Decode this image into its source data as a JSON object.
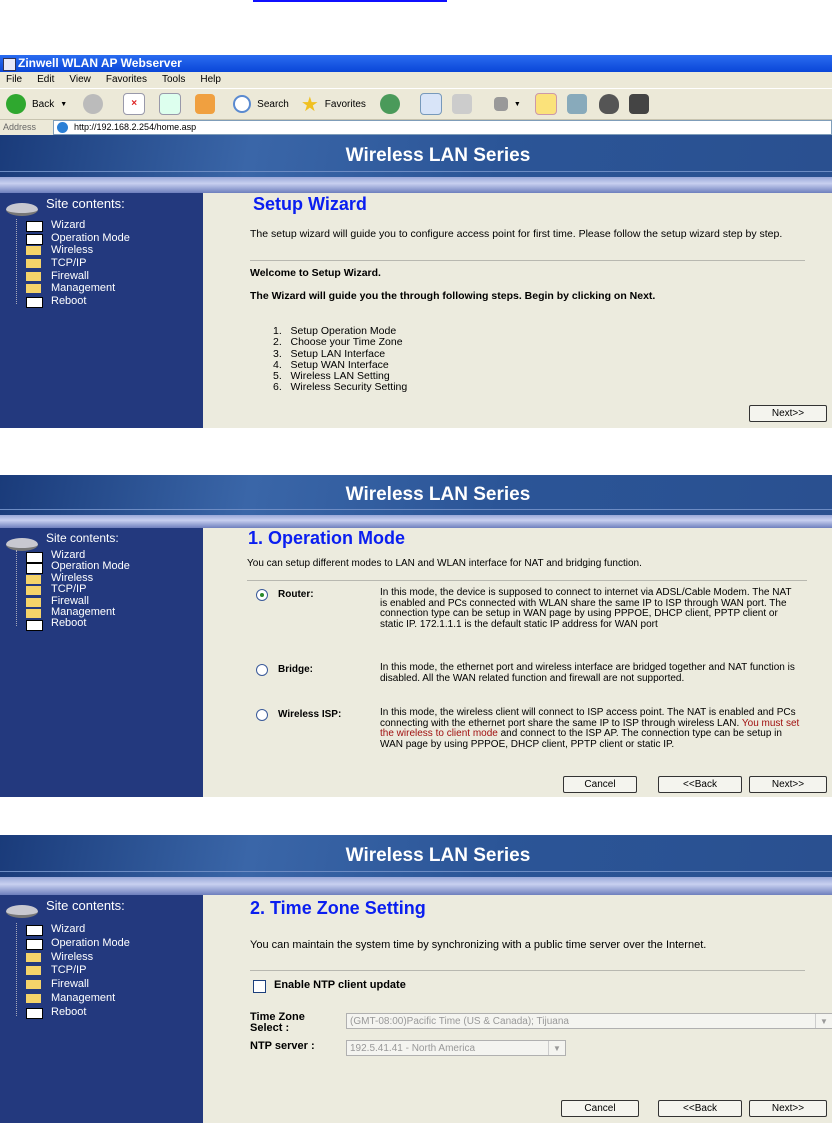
{
  "browser": {
    "title": "Zinwell WLAN AP Webserver",
    "menu": [
      "File",
      "Edit",
      "View",
      "Favorites",
      "Tools",
      "Help"
    ],
    "toolbar": {
      "back": "Back",
      "search": "Search",
      "favorites": "Favorites"
    },
    "address_label": "Address",
    "url": "http://192.168.2.254/home.asp"
  },
  "banner": "Wireless LAN Series",
  "sidebar": {
    "title": "Site contents:",
    "items": [
      "Wizard",
      "Operation Mode",
      "Wireless",
      "TCP/IP",
      "Firewall",
      "Management",
      "Reboot"
    ]
  },
  "wizard": {
    "title": "Setup Wizard",
    "intro": "The setup wizard will guide you to configure access point for first time. Please follow the setup wizard step by step.",
    "welcome": "Welcome to Setup Wizard.",
    "guide": "The Wizard will guide you the through following steps. Begin by clicking on Next.",
    "steps": [
      "1.   Setup Operation Mode",
      "2.   Choose your Time Zone",
      "3.   Setup LAN Interface",
      "4.   Setup WAN Interface",
      "5.   Wireless LAN Setting",
      "6.   Wireless Security Setting"
    ],
    "next": "Next>>"
  },
  "opmode": {
    "title": "1. Operation Mode",
    "intro": "You can setup different modes to LAN and WLAN interface for NAT and bridging function.",
    "modes": [
      {
        "label": "Router:",
        "selected": true,
        "desc": "In this mode, the device is supposed to connect to internet via ADSL/Cable Modem. The NAT is enabled and PCs connected with WLAN share the same IP to ISP through WAN port. The connection type can be setup in WAN page by using PPPOE, DHCP client, PPTP client or static IP. 172.1.1.1 is the default static IP address for WAN port"
      },
      {
        "label": "Bridge:",
        "selected": false,
        "desc": "In this mode, the ethernet port and wireless interface are bridged together and NAT function is disabled. All the WAN related function and firewall are not supported."
      },
      {
        "label": "Wireless ISP:",
        "selected": false,
        "desc_a": "In this mode, the wireless client will connect to ISP access point. The NAT is enabled and PCs connecting with the ethernet port share the same IP to ISP through wireless LAN. ",
        "desc_red": "You must set the wireless to client mode",
        "desc_b": " and connect to the ISP AP. The connection type can be setup in WAN page by using PPPOE, DHCP client, PPTP client or static IP."
      }
    ],
    "cancel": "Cancel",
    "back": "<<Back",
    "next": "Next>>"
  },
  "timezone": {
    "title": "2. Time Zone Setting",
    "intro": "You can maintain the system time by synchronizing with a public time server over the Internet.",
    "ntp_label": "Enable NTP client update",
    "ntp_enabled": false,
    "tz_label": "Time Zone Select :",
    "tz_value": "(GMT-08:00)Pacific Time (US & Canada); Tijuana",
    "server_label": "NTP server :",
    "server_value": "192.5.41.41 - North America",
    "cancel": "Cancel",
    "back": "<<Back",
    "next": "Next>>"
  },
  "colors": {
    "banner": "#2b5597",
    "sidebar": "#23397e",
    "content": "#ecebde",
    "heading": "#0a1ef0",
    "warning": "#a01010"
  }
}
